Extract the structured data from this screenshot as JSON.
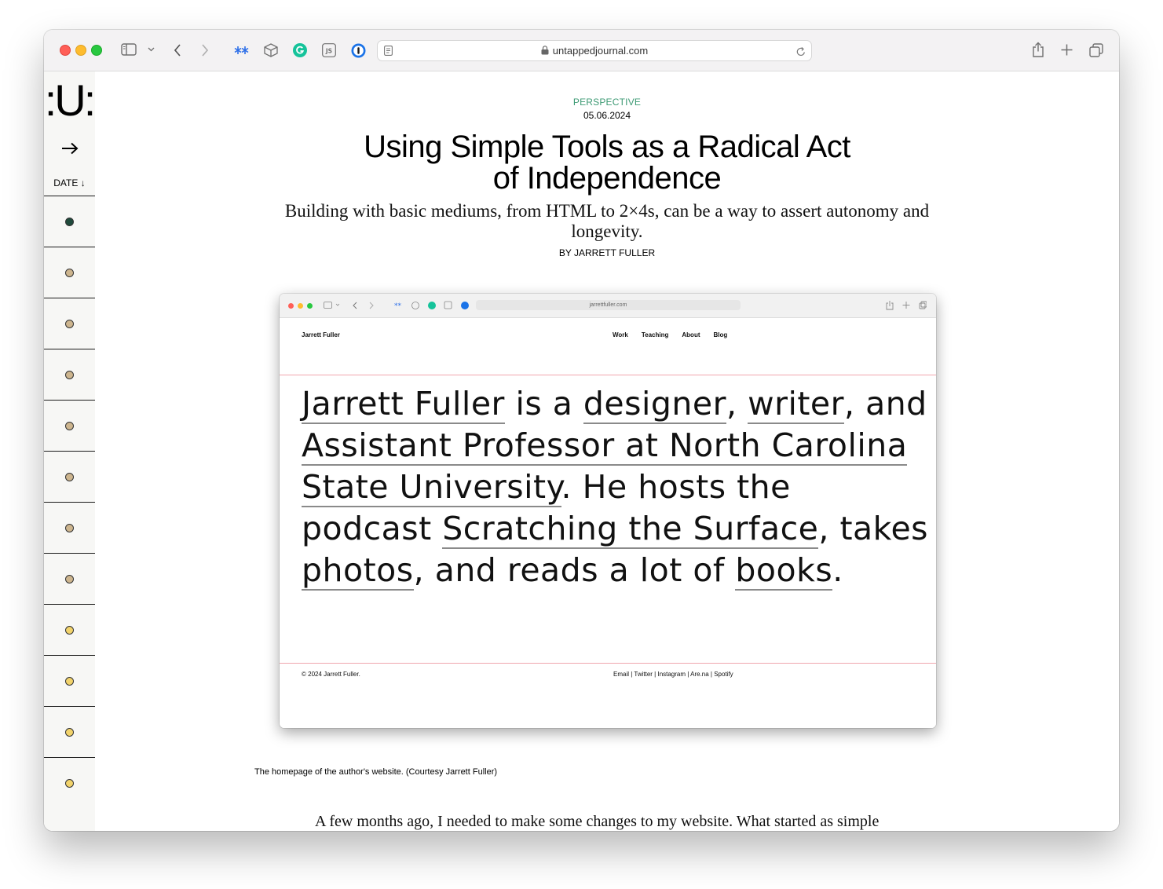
{
  "browser": {
    "url": "untappedjournal.com",
    "extensions": [
      "asterisk-extension",
      "box-extension",
      "grammarly-extension",
      "js-extension",
      "password-extension"
    ]
  },
  "sidebar": {
    "logo": ":U:",
    "arrow": "→",
    "sort_label": "DATE ↓",
    "dot_colors": [
      "#1f4a3b",
      "#cdb58e",
      "#cdb58e",
      "#cdb58e",
      "#cdb58e",
      "#cdb58e",
      "#cdb58e",
      "#cdb58e",
      "#f2d36b",
      "#f2d36b",
      "#f2d36b",
      "#f2d36b"
    ]
  },
  "article": {
    "category": "PERSPECTIVE",
    "date": "05.06.2024",
    "title_line1": "Using Simple Tools as a Radical Act",
    "title_line2": "of Independence",
    "dek": "Building with basic mediums, from HTML to 2×4s, can be a way to assert autonomy and longevity.",
    "byline": "BY JARRETT FULLER",
    "caption": "The homepage of the author's website. (Courtesy Jarrett Fuller)",
    "body_first_line": "A few months ago, I needed to make some changes to my website. What started as simple"
  },
  "screenshot": {
    "url": "jarrettfuller.com",
    "site_name": "Jarrett Fuller",
    "nav": [
      "Work",
      "Teaching",
      "About",
      "Blog"
    ],
    "hero": {
      "t1": "Jarrett Fuller",
      "t2": " is a ",
      "t3": "designer",
      "t4": ", ",
      "t5": "writer",
      "t6": ", and ",
      "t7": "Assistant Professor at North Carolina State University",
      "t8": ". He hosts the podcast ",
      "t9": "Scratching the Surface",
      "t10": ", takes ",
      "t11": "photos",
      "t12": ", and reads a lot of ",
      "t13": "books",
      "t14": "."
    },
    "copyright": "© 2024 Jarrett Fuller.",
    "footer_links": "Email | Twitter | Instagram | Are.na | Spotify"
  }
}
